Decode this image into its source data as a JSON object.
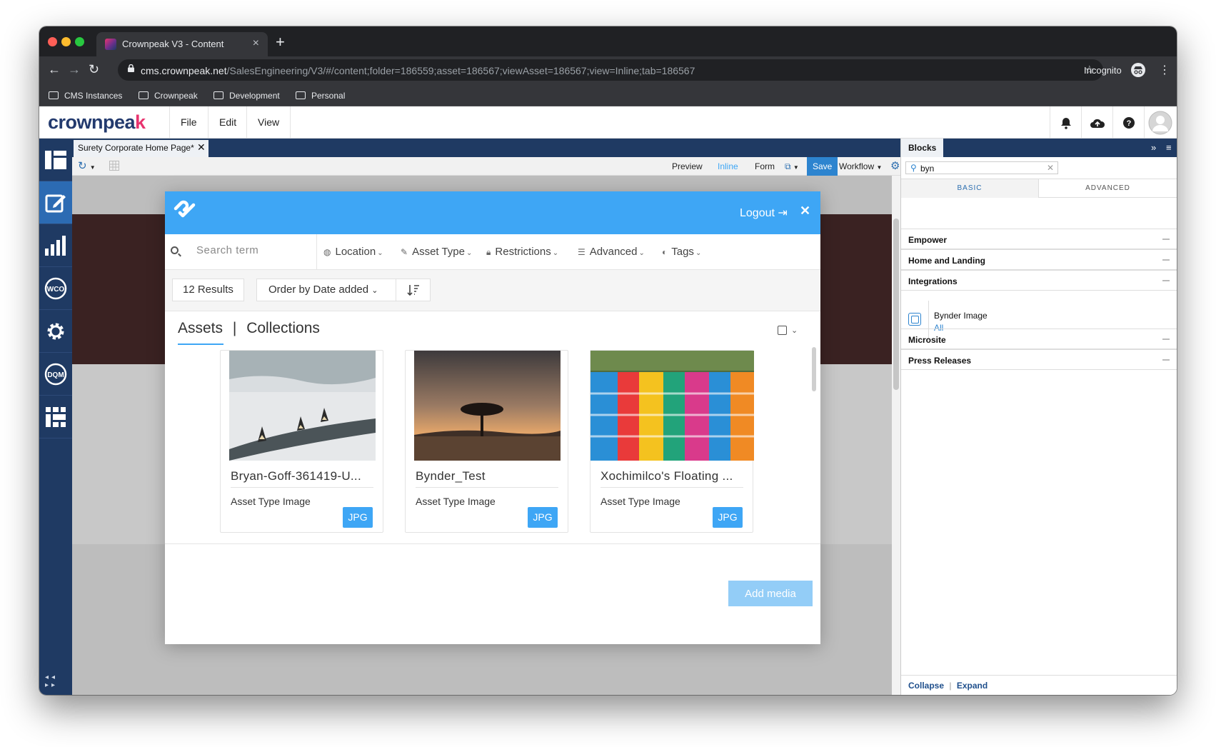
{
  "browser": {
    "tab_title": "Crownpeak V3 - Content",
    "url_host": "cms.crownpeak.net",
    "url_path": "/SalesEngineering/V3/#/content;folder=186559;asset=186567;viewAsset=186567;view=Inline;tab=186567",
    "incognito_label": "Incognito",
    "bookmarks": [
      "CMS Instances",
      "Crownpeak",
      "Development",
      "Personal"
    ]
  },
  "app": {
    "logo_main": "crownpea",
    "logo_accent": "k",
    "menu": [
      "File",
      "Edit",
      "View"
    ]
  },
  "content": {
    "tab_label": "Surety Corporate Home Page*",
    "toolbar": {
      "preview": "Preview",
      "inline": "Inline",
      "form": "Form",
      "save": "Save",
      "workflow": "Workflow"
    }
  },
  "blocks": {
    "title": "Blocks",
    "search_value": "byn",
    "tabs": [
      "BASIC",
      "ADVANCED"
    ],
    "groups": [
      "Empower",
      "Home and Landing",
      "Integrations",
      "Microsite",
      "Press Releases"
    ],
    "item": {
      "name": "Bynder Image",
      "link": "All"
    },
    "footer": {
      "collapse": "Collapse",
      "separator": "|",
      "expand": "Expand"
    }
  },
  "modal": {
    "logout": "Logout",
    "search_placeholder": "Search term",
    "filters": [
      "Location",
      "Asset Type",
      "Restrictions",
      "Advanced",
      "Tags"
    ],
    "results": "12 Results",
    "order_prefix": "Order by",
    "order_value": "Date added",
    "tabs": {
      "assets": "Assets",
      "sep": "|",
      "collections": "Collections"
    },
    "cards": [
      {
        "name": "Bryan-Goff-361419-U...",
        "type": "Asset Type Image",
        "badge": "JPG"
      },
      {
        "name": "Bynder_Test",
        "type": "Asset Type Image",
        "badge": "JPG"
      },
      {
        "name": "Xochimilco's Floating ...",
        "type": "Asset Type Image",
        "badge": "JPG"
      }
    ],
    "add_media": "Add media"
  },
  "colors": {
    "nav_dark": "#1f3a63",
    "accent_blue": "#3ea6f5",
    "brand_pink": "#e8346f"
  }
}
